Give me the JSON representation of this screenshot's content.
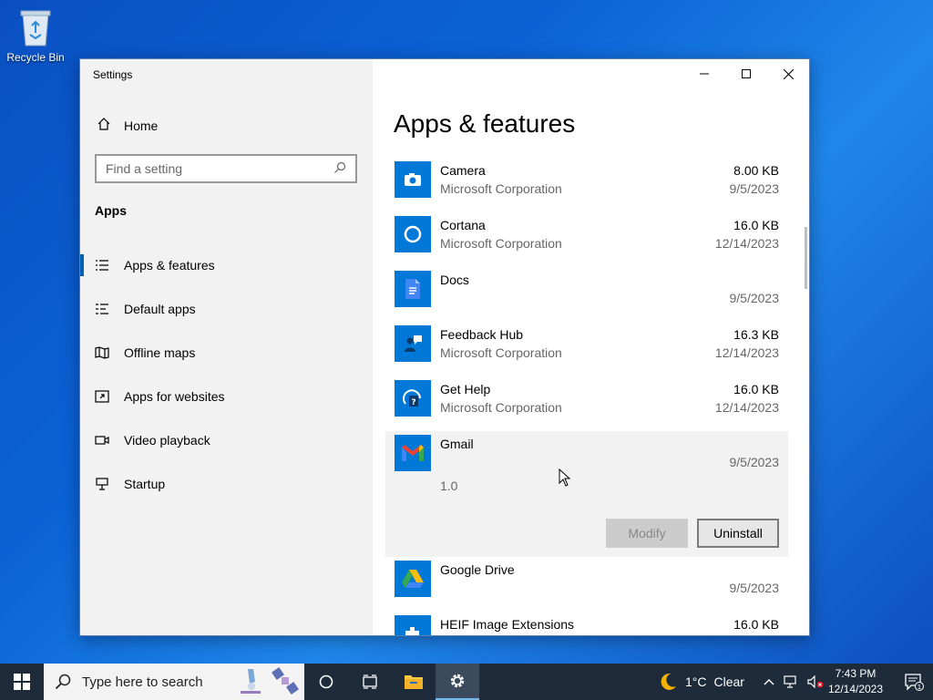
{
  "desktop": {
    "recycle_bin_label": "Recycle Bin"
  },
  "window": {
    "title": "Settings"
  },
  "sidebar": {
    "home_label": "Home",
    "search_placeholder": "Find a setting",
    "section_title": "Apps",
    "items": [
      {
        "label": "Apps & features",
        "icon": "list-icon",
        "active": true
      },
      {
        "label": "Default apps",
        "icon": "default-apps-icon",
        "active": false
      },
      {
        "label": "Offline maps",
        "icon": "map-icon",
        "active": false
      },
      {
        "label": "Apps for websites",
        "icon": "link-window-icon",
        "active": false
      },
      {
        "label": "Video playback",
        "icon": "video-icon",
        "active": false
      },
      {
        "label": "Startup",
        "icon": "startup-icon",
        "active": false
      }
    ]
  },
  "main": {
    "title": "Apps & features",
    "apps": [
      {
        "name": "Camera",
        "publisher": "Microsoft Corporation",
        "size": "8.00 KB",
        "date": "9/5/2023",
        "icon": "camera-icon"
      },
      {
        "name": "Cortana",
        "publisher": "Microsoft Corporation",
        "size": "16.0 KB",
        "date": "12/14/2023",
        "icon": "cortana-icon"
      },
      {
        "name": "Docs",
        "publisher": "",
        "size": "",
        "date": "9/5/2023",
        "icon": "docs-icon"
      },
      {
        "name": "Feedback Hub",
        "publisher": "Microsoft Corporation",
        "size": "16.3 KB",
        "date": "12/14/2023",
        "icon": "feedback-hub-icon"
      },
      {
        "name": "Get Help",
        "publisher": "Microsoft Corporation",
        "size": "16.0 KB",
        "date": "12/14/2023",
        "icon": "get-help-icon"
      },
      {
        "name": "Gmail",
        "publisher": "",
        "size": "",
        "date": "9/5/2023",
        "version": "1.0",
        "icon": "gmail-icon",
        "expanded": true
      },
      {
        "name": "Google Drive",
        "publisher": "",
        "size": "",
        "date": "9/5/2023",
        "icon": "google-drive-icon"
      },
      {
        "name": "HEIF Image Extensions",
        "publisher": "",
        "size": "16.0 KB",
        "date": "",
        "icon": "heif-icon"
      }
    ],
    "modify_label": "Modify",
    "uninstall_label": "Uninstall"
  },
  "taskbar": {
    "search_placeholder": "Type here to search",
    "weather_temp": "1°C",
    "weather_desc": "Clear",
    "time": "7:43 PM",
    "date": "12/14/2023",
    "notification_count": "1"
  },
  "colors": {
    "accent": "#0063b1",
    "app_tile": "#0078d7",
    "taskbar": "#1d2b3a"
  }
}
